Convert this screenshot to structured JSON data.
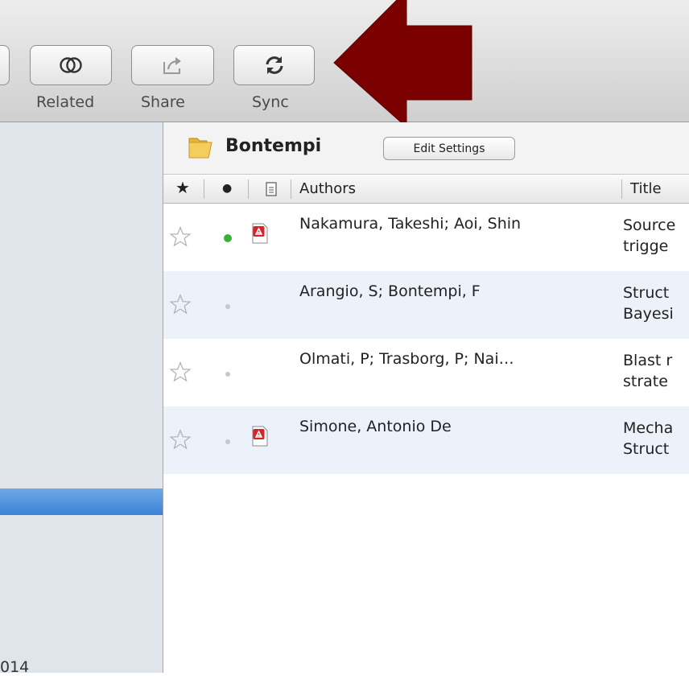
{
  "toolbar": {
    "buttons": [
      {
        "id": "related",
        "label": "Related",
        "icon": "related-icon"
      },
      {
        "id": "share",
        "label": "Share",
        "icon": "share-icon"
      },
      {
        "id": "sync",
        "label": "Sync",
        "icon": "sync-icon"
      }
    ],
    "annotation_arrow_color": "#7a0000"
  },
  "sidebar": {
    "selected_color": "#3b82d6",
    "partial_text": "014"
  },
  "folder": {
    "name": "Bontempi",
    "edit_button": "Edit Settings",
    "icon": "folder-icon"
  },
  "columns": {
    "star": "★",
    "read": "●",
    "file": "file-icon",
    "authors": "Authors",
    "title": "Title"
  },
  "documents": [
    {
      "starred": false,
      "read_status": "unread",
      "has_pdf": true,
      "authors": "Nakamura, Takeshi; Aoi, Shin",
      "title_line1": "Source",
      "title_line2": "trigge"
    },
    {
      "starred": false,
      "read_status": "read",
      "has_pdf": false,
      "authors": "Arangio, S; Bontempi, F",
      "title_line1": "Struct",
      "title_line2": "Bayesi"
    },
    {
      "starred": false,
      "read_status": "read",
      "has_pdf": false,
      "authors": "Olmati, P; Trasborg, P; Nai…",
      "title_line1": "Blast r",
      "title_line2": "strate"
    },
    {
      "starred": false,
      "read_status": "read",
      "has_pdf": true,
      "authors": "Simone, Antonio De",
      "title_line1": "Mecha",
      "title_line2": "Struct"
    }
  ]
}
